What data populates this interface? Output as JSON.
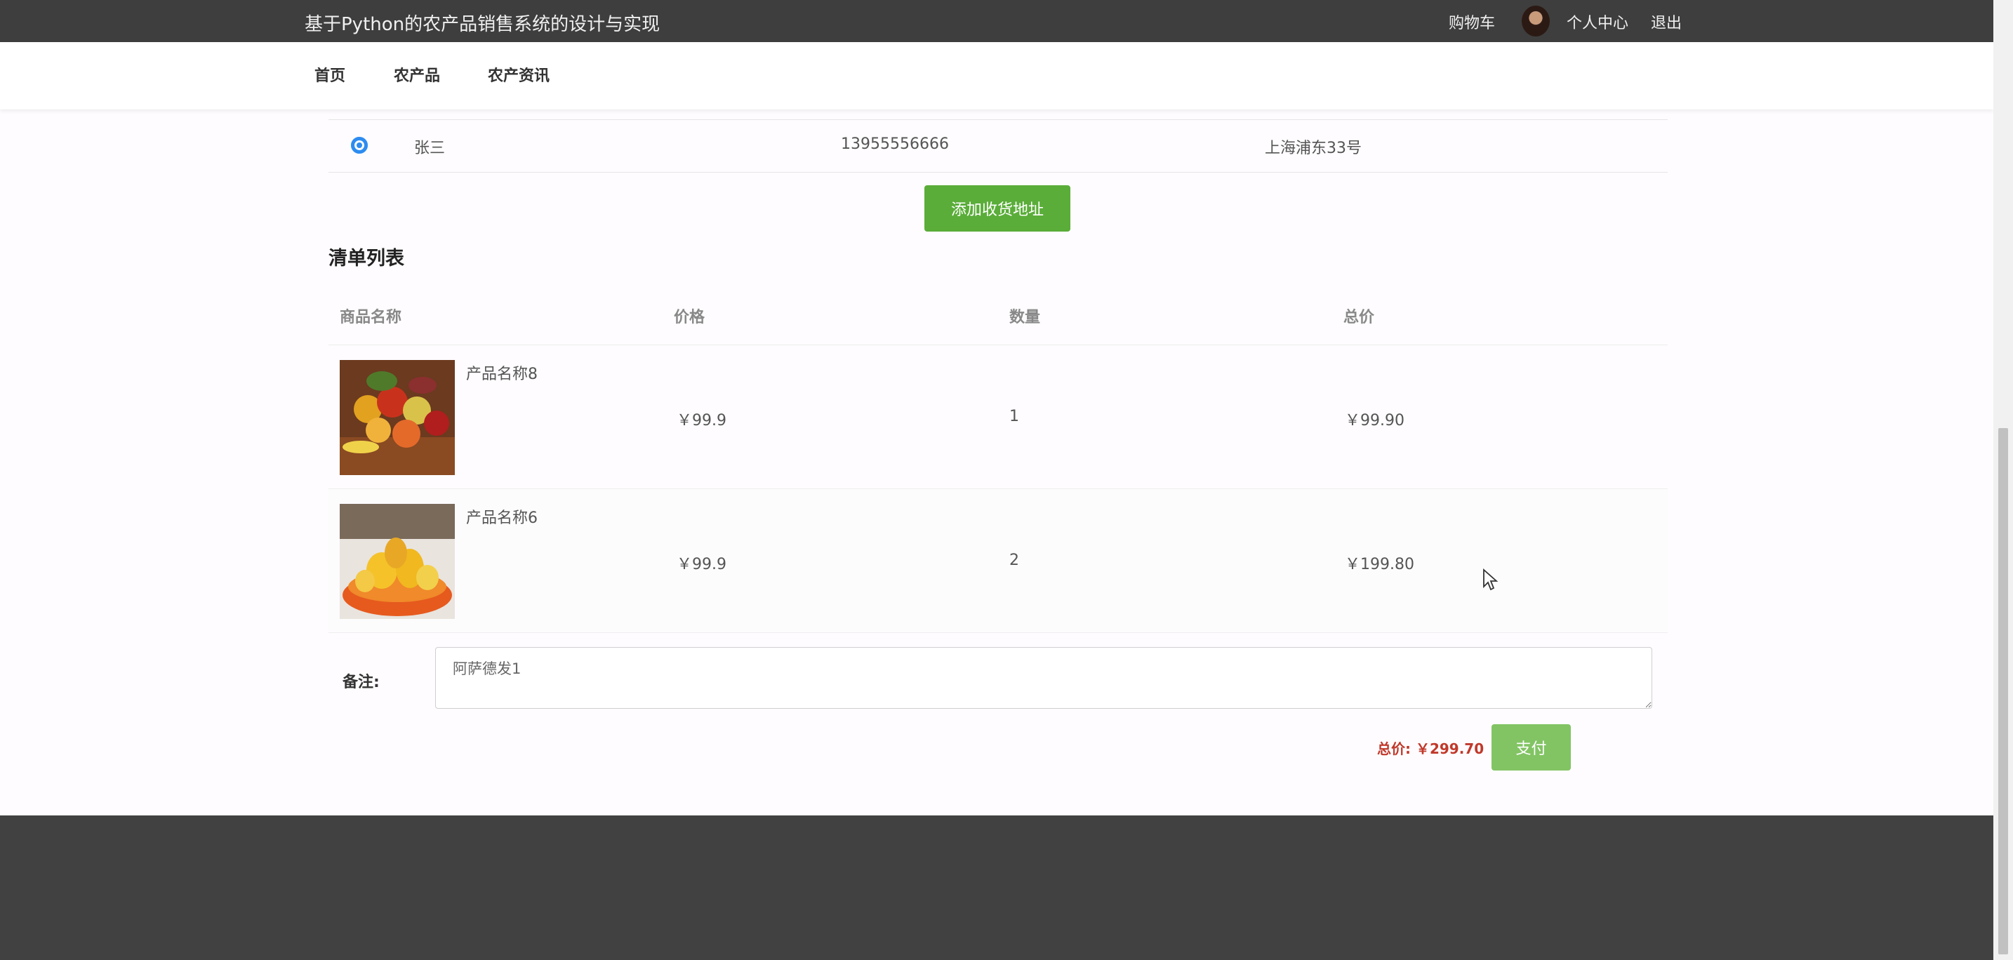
{
  "header": {
    "title": "基于Python的农产品销售系统的设计与实现",
    "cart": "购物车",
    "profile": "个人中心",
    "logout": "退出"
  },
  "nav": {
    "items": [
      "首页",
      "农产品",
      "农产资讯"
    ]
  },
  "address": {
    "selected": true,
    "name": "张三",
    "phone": "13955556666",
    "address": "上海浦东33号"
  },
  "add_address_label": "添加收货地址",
  "list_title": "清单列表",
  "table": {
    "headers": [
      "商品名称",
      "价格",
      "数量",
      "总价"
    ],
    "rows": [
      {
        "name": "产品名称8",
        "price": "￥99.9",
        "qty": "1",
        "total": "￥99.90"
      },
      {
        "name": "产品名称6",
        "price": "￥99.9",
        "qty": "2",
        "total": "￥199.80"
      }
    ]
  },
  "remark": {
    "label": "备注:",
    "value": "阿萨德发1"
  },
  "summary": {
    "total_label": "总价: ￥299.70"
  },
  "pay_label": "支付",
  "colors": {
    "topbar": "#3e3e3e",
    "add_button": "#5aad39",
    "pay_button": "#82c464",
    "total_text": "#c0392b",
    "radio": "#2d8cf0",
    "footer": "#414141"
  }
}
